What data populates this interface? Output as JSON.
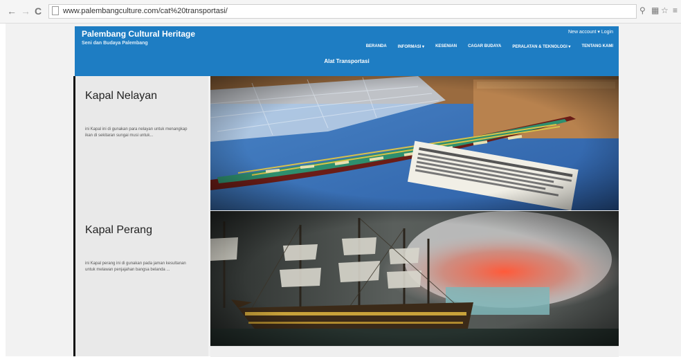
{
  "browser": {
    "back": "←",
    "forward": "→",
    "reload": "C",
    "url": "www.palembangculture.com/cat%20transportasi/",
    "icons": [
      "zoom-icon",
      "translate-icon",
      "star-icon",
      "menu-icon"
    ]
  },
  "site": {
    "title": "Palembang Cultural Heritage",
    "subtitle": "Seni dan Budaya Palembang",
    "login": "New account ▾ Login",
    "nav": [
      {
        "label": "BERANDA"
      },
      {
        "label": "INFORMASI ▾"
      },
      {
        "label": "KESENIAN"
      },
      {
        "label": "CAGAR BUDAYA"
      },
      {
        "label": "PERALATAN & TEKNOLOGI ▾"
      },
      {
        "label": "TENTANG KAMI"
      }
    ],
    "page_heading": "Alat Transportasi",
    "brand_color": "#1e7dc3"
  },
  "items": [
    {
      "title": "Kapal Nelayan",
      "description": "ini Kapal ini di gunakan para nelayan untuk menangkap ikan di sekitaran sungai musi untuk..."
    },
    {
      "title": "Kapal Perang",
      "description": "ini Kapal perang ini di gunakan pada jaman kesultanan untuk melawan penjajahan bangsa belanda ..."
    }
  ]
}
